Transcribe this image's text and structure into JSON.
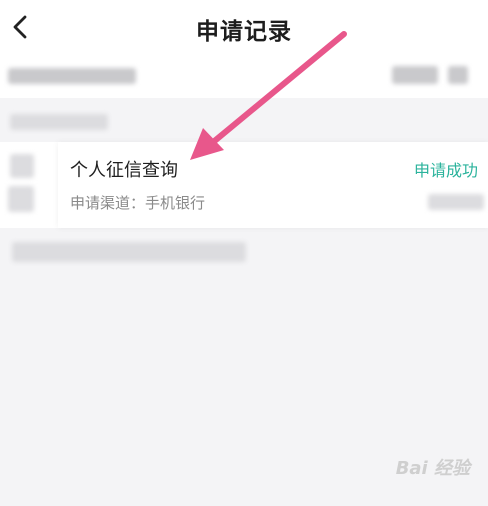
{
  "header": {
    "title": "申请记录",
    "back_icon": "chevron-left-icon"
  },
  "record": {
    "title": "个人征信查询",
    "status": "申请成功",
    "status_color": "#2bb39c",
    "channel": "申请渠道：手机银行"
  },
  "watermark": "Bai 经验",
  "annotation": {
    "arrow_color": "#e8578b"
  }
}
